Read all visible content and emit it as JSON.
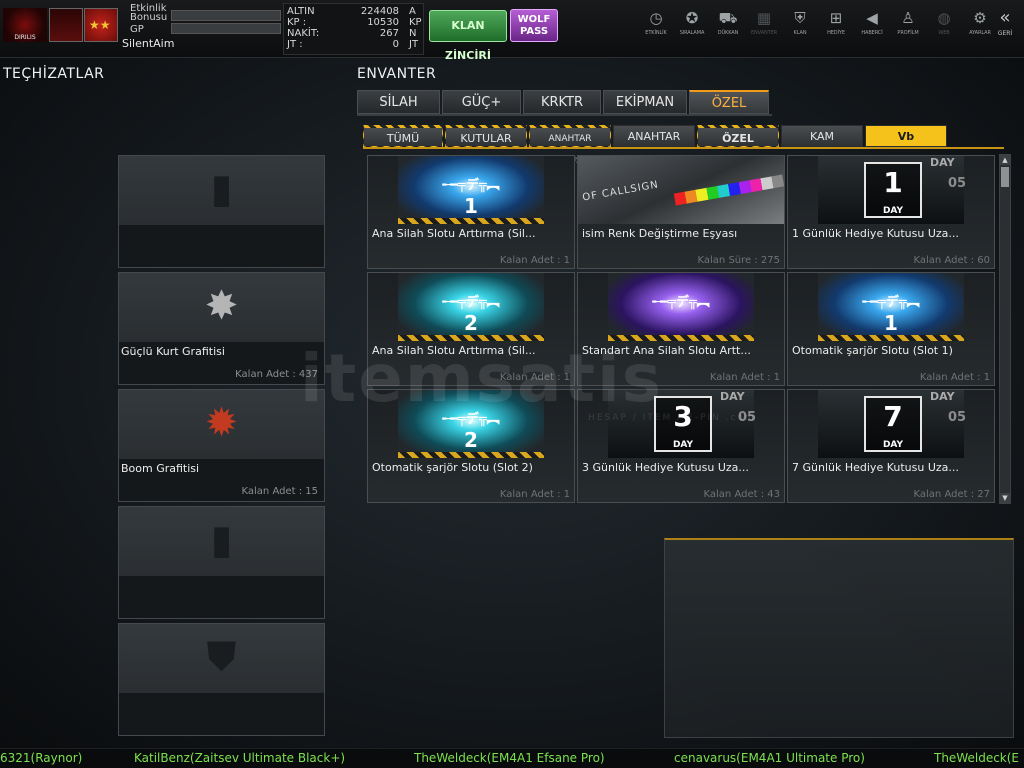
{
  "header": {
    "xp_labels": [
      "Etkinlik",
      "Bonusu",
      "GP"
    ],
    "username": "SilentAim",
    "currencies": [
      {
        "name": "ALTIN",
        "value": "224408",
        "unit": "A"
      },
      {
        "name": "KP :",
        "value": "10530",
        "unit": "KP"
      },
      {
        "name": "NAKİT:",
        "value": "267",
        "unit": "N"
      },
      {
        "name": "JT :",
        "value": "0",
        "unit": "JT"
      }
    ],
    "clan_chain_label": "KLAN ZİNCİRİ",
    "wolf_pass_line1": "WOLF",
    "wolf_pass_line2": "PASS",
    "logo_caption": "DIRILIS"
  },
  "topnav": [
    {
      "label": "ETKİNLİK",
      "icon": "clock-icon",
      "glyph": "◷"
    },
    {
      "label": "SIRALAMA",
      "icon": "medal-icon",
      "glyph": "✪"
    },
    {
      "label": "DÜKKAN",
      "icon": "cart-icon",
      "glyph": "⛟"
    },
    {
      "label": "ENVANTER",
      "icon": "inventory-icon",
      "glyph": "▦"
    },
    {
      "label": "KLAN",
      "icon": "clan-shield-icon",
      "glyph": "⛨"
    },
    {
      "label": "HEDİYE",
      "icon": "gift-icon",
      "glyph": "⊞"
    },
    {
      "label": "HABERCİ",
      "icon": "megaphone-icon",
      "glyph": "◀"
    },
    {
      "label": "PROFİLM",
      "icon": "profile-icon",
      "glyph": "♙"
    },
    {
      "label": "WEB",
      "icon": "globe-icon",
      "glyph": "◍"
    },
    {
      "label": "AYARLAR",
      "icon": "gear-icon",
      "glyph": "⚙"
    }
  ],
  "back_label": "GERİ",
  "equipment": {
    "title": "TEÇHİZATLAR",
    "slots": [
      {
        "name": "",
        "qty": "",
        "art": "spray-can-icon"
      },
      {
        "name": "Güçlü Kurt Grafitisi",
        "qty": "Kalan Adet : 437",
        "art": "wolf-graffiti-icon"
      },
      {
        "name": "Boom Grafitisi",
        "qty": "Kalan Adet : 15",
        "art": "boom-graffiti-icon"
      },
      {
        "name": "",
        "qty": "",
        "art": "spray-can-icon"
      },
      {
        "name": "",
        "qty": "",
        "art": "shield-icon"
      }
    ]
  },
  "inventory": {
    "title": "ENVANTER",
    "tabs": [
      "SİLAH",
      "GÜÇ+",
      "KRKTR",
      "EKİPMAN",
      "ÖZEL"
    ],
    "active_tab": "ÖZEL",
    "sub_tabs": [
      "TÜMÜ",
      "KUTULAR",
      "ANAHTAR KUTUSU",
      "ANAHTAR",
      "ÖZEL EŞYALAR",
      "KAM",
      "Vb"
    ],
    "active_sub_tab": "Vb",
    "items": [
      {
        "name": "Ana Silah Slotu Arttırma (Sil...",
        "meta": "Kalan Adet : 1",
        "thumb": "energy",
        "num": "1"
      },
      {
        "name": "isim Renk Değiştirme Eşyası",
        "meta": "Kalan Süre : 275",
        "thumb": "callsign",
        "num": "",
        "caption": "OF CALLSIGN"
      },
      {
        "name": "1 Günlük Hediye Kutusu Uza...",
        "meta": "Kalan Adet : 60",
        "thumb": "day",
        "num": "1",
        "day_label": "DAY",
        "side1": "DAY",
        "side2": "05"
      },
      {
        "name": "Ana Silah Slotu Arttırma (Sil...",
        "meta": "Kalan Adet : 1",
        "thumb": "energy2",
        "num": "2"
      },
      {
        "name": "Standart Ana Silah Slotu Artt...",
        "meta": "Kalan Adet : 1",
        "thumb": "purple",
        "num": ""
      },
      {
        "name": "Otomatik şarjör Slotu (Slot 1)",
        "meta": "Kalan Adet : 1",
        "thumb": "energy",
        "num": "1"
      },
      {
        "name": "Otomatik şarjör Slotu (Slot 2)",
        "meta": "Kalan Adet : 1",
        "thumb": "energy2",
        "num": "2"
      },
      {
        "name": "3 Günlük Hediye Kutusu Uza...",
        "meta": "Kalan Adet : 43",
        "thumb": "day",
        "num": "3",
        "day_label": "DAY",
        "side1": "DAY",
        "side2": "05"
      },
      {
        "name": "7 Günlük Hediye Kutusu Uza...",
        "meta": "Kalan Adet : 27",
        "thumb": "day",
        "num": "7",
        "day_label": "DAY",
        "side1": "DAY",
        "side2": "05"
      }
    ]
  },
  "watermark": {
    "text": "itemsatis",
    "sub": "HESAP / ITEM / E-PIN .com"
  },
  "ticker": [
    "6321(Raynor)",
    "KatilBenz(Zaitsev Ultimate Black+)",
    "TheWeldeck(EM4A1 Efsane Pro)",
    "cenavarus(EM4A1 Ultimate Pro)",
    "TheWeldeck(E"
  ],
  "colors": {
    "accent": "#f29a19",
    "active_subtab": "#f5c21b",
    "ticker": "#7ce14e",
    "clan_btn": "#2f8a3b",
    "wolf_btn": "#9a45c0"
  }
}
